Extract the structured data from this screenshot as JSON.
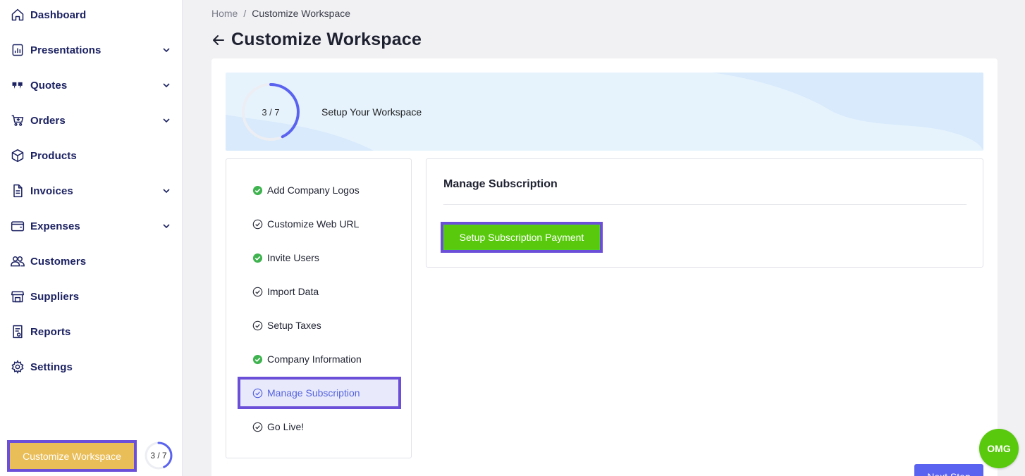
{
  "sidebar": {
    "items": [
      {
        "label": "Dashboard",
        "icon": "home-icon",
        "has_chevron": false
      },
      {
        "label": "Presentations",
        "icon": "presentation-chart-icon",
        "has_chevron": true
      },
      {
        "label": "Quotes",
        "icon": "quote-icon",
        "has_chevron": true
      },
      {
        "label": "Orders",
        "icon": "cart-icon",
        "has_chevron": true
      },
      {
        "label": "Products",
        "icon": "box-icon",
        "has_chevron": false
      },
      {
        "label": "Invoices",
        "icon": "document-icon",
        "has_chevron": true
      },
      {
        "label": "Expenses",
        "icon": "wallet-icon",
        "has_chevron": true
      },
      {
        "label": "Customers",
        "icon": "users-icon",
        "has_chevron": false
      },
      {
        "label": "Suppliers",
        "icon": "store-icon",
        "has_chevron": false
      },
      {
        "label": "Reports",
        "icon": "report-icon",
        "has_chevron": false
      },
      {
        "label": "Settings",
        "icon": "gear-icon",
        "has_chevron": false
      }
    ],
    "customize_button": "Customize Workspace",
    "progress_text": "3 / 7",
    "progress_fraction": 0.4286
  },
  "breadcrumb": {
    "home": "Home",
    "separator": "/",
    "current": "Customize Workspace"
  },
  "page": {
    "title": "Customize Workspace"
  },
  "banner": {
    "progress_text": "3 / 7",
    "progress_fraction": 0.4286,
    "title": "Setup Your Workspace"
  },
  "steps": [
    {
      "label": "Add Company Logos",
      "status": "complete"
    },
    {
      "label": "Customize Web URL",
      "status": "pending"
    },
    {
      "label": "Invite Users",
      "status": "complete"
    },
    {
      "label": "Import Data",
      "status": "pending"
    },
    {
      "label": "Setup Taxes",
      "status": "pending"
    },
    {
      "label": "Company Information",
      "status": "complete"
    },
    {
      "label": "Manage Subscription",
      "status": "active"
    },
    {
      "label": "Go Live!",
      "status": "pending"
    }
  ],
  "panel": {
    "heading": "Manage Subscription",
    "button": "Setup Subscription Payment"
  },
  "footer": {
    "next_button": "Next Step"
  },
  "chat_bubble": "OMG",
  "colors": {
    "navy": "#1c2262",
    "accent": "#5a62f0",
    "green": "#58c90c",
    "gold": "#e9bd57",
    "highlight": "#6b4fd8",
    "banner_bg": "#e6f3fd"
  }
}
